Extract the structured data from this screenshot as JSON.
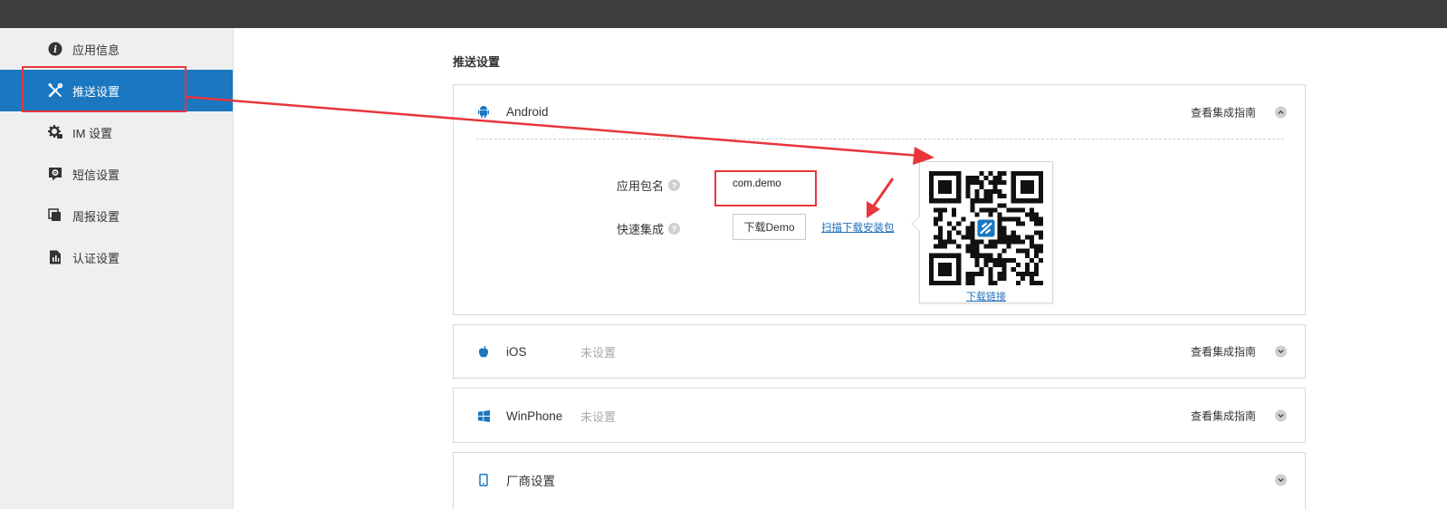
{
  "sidebar": {
    "items": [
      {
        "label": "应用信息",
        "icon": "info-icon"
      },
      {
        "label": "推送设置",
        "icon": "tools-icon"
      },
      {
        "label": "IM 设置",
        "icon": "gear-chat-icon"
      },
      {
        "label": "短信设置",
        "icon": "sms-gear-icon"
      },
      {
        "label": "周报设置",
        "icon": "report-pages-icon"
      },
      {
        "label": "认证设置",
        "icon": "certificate-doc-icon"
      }
    ],
    "active_index": 1
  },
  "main": {
    "section_title": "推送设置",
    "android": {
      "name": "Android",
      "guide": "查看集成指南",
      "package_label": "应用包名",
      "package_value": "com.demo",
      "quick_label": "快速集成",
      "download_demo": "下载Demo",
      "scan_link": "扫描下载安装包",
      "qr_caption": "下载链接"
    },
    "ios": {
      "name": "iOS",
      "state": "未设置",
      "guide": "查看集成指南"
    },
    "winphone": {
      "name": "WinPhone",
      "state": "未设置",
      "guide": "查看集成指南"
    },
    "vendor": {
      "name": "厂商设置"
    }
  },
  "colors": {
    "topbar": "#3d3d3d",
    "active": "#1a77c0",
    "annotation": "#e8363b",
    "link": "#1f6fb7"
  }
}
